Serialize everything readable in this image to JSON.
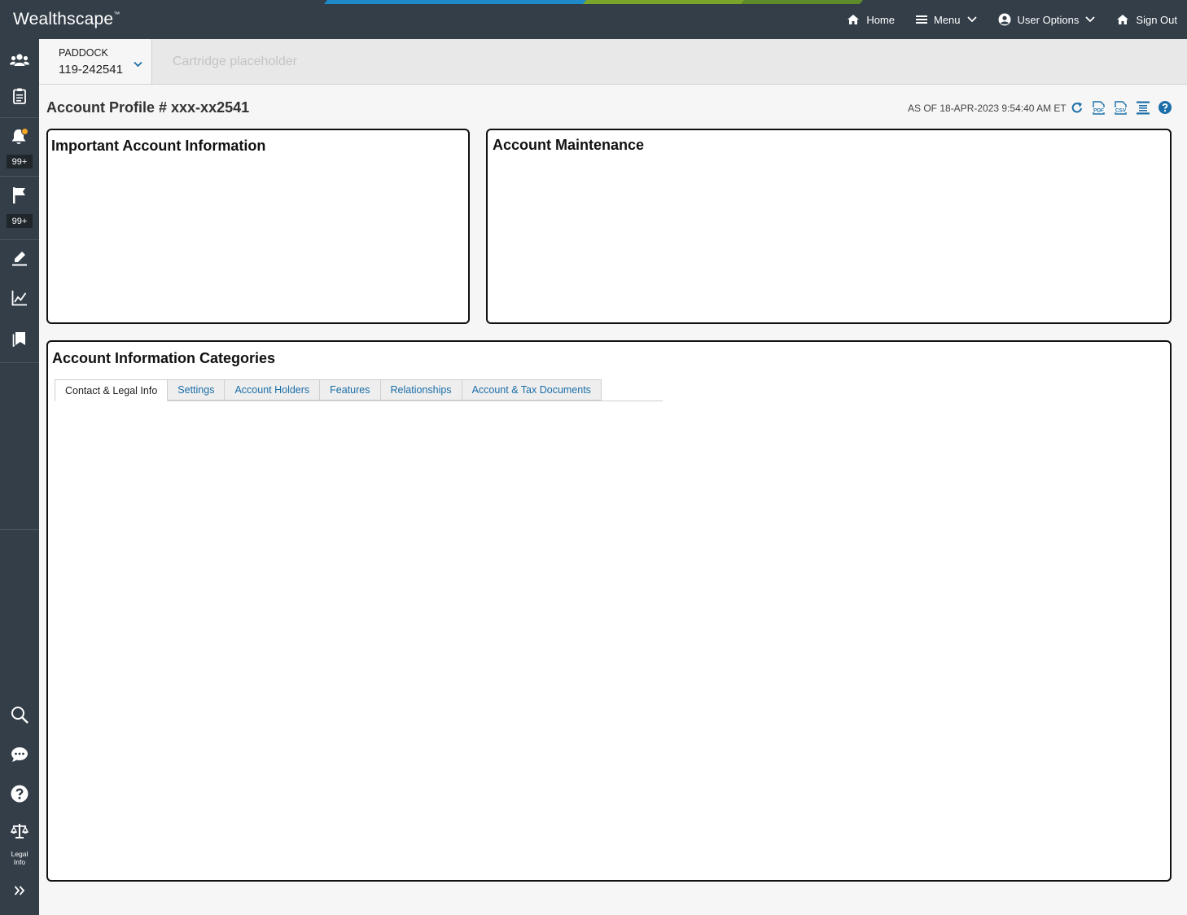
{
  "header": {
    "logo_text": "Wealthscape",
    "logo_mark": "™",
    "nav": [
      {
        "label": "Home",
        "icon": "home-icon"
      },
      {
        "label": "Menu",
        "icon": "hamburger-icon"
      },
      {
        "label": "User Options",
        "icon": "user-circle-icon"
      },
      {
        "label": "Sign Out",
        "icon": "home-icon"
      }
    ]
  },
  "rail": {
    "notifications_badge": "99+",
    "flags_badge": "99+",
    "legal_label_line1": "Legal",
    "legal_label_line2": "Info"
  },
  "account_bar": {
    "name": "PADDOCK",
    "number": "119-242541",
    "cartridge_placeholder": "Cartridge placeholder"
  },
  "page": {
    "title": "Account Profile # xxx-xx2541",
    "as_of": "AS OF 18-APR-2023  9:54:40 AM ET"
  },
  "panels": {
    "important_title": "Important Account Information",
    "maintenance_title": "Account Maintenance",
    "categories_title": "Account Information Categories"
  },
  "tabs": [
    {
      "label": "Contact & Legal Info",
      "active": true
    },
    {
      "label": "Settings",
      "active": false
    },
    {
      "label": "Account Holders",
      "active": false
    },
    {
      "label": "Features",
      "active": false
    },
    {
      "label": "Relationships",
      "active": false
    },
    {
      "label": "Account & Tax Documents",
      "active": false
    }
  ],
  "colors": {
    "topbar": "#333e48",
    "link": "#1b6ea8",
    "stripe_blue": "#1f8ac8",
    "stripe_green": "#7aa52a",
    "notification_dot": "#f5a623"
  }
}
